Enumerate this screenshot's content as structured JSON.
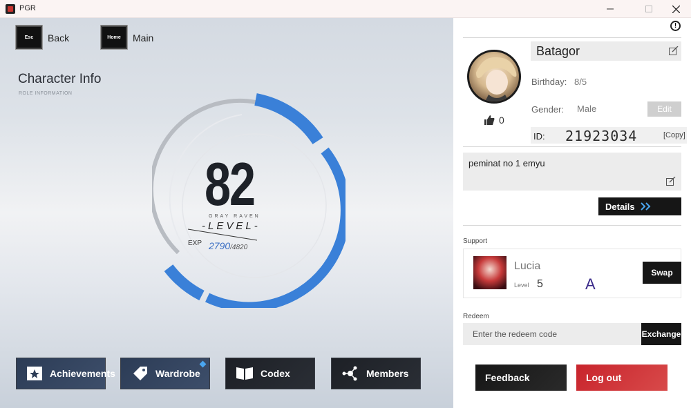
{
  "window": {
    "title": "PGR",
    "min_icon": "minimize-icon",
    "max_icon": "maximize-icon",
    "close_icon": "close-icon"
  },
  "topnav": {
    "back_key": "Esc",
    "back_label": "Back",
    "main_key": "Home",
    "main_label": "Main"
  },
  "character": {
    "title": "Character Info",
    "subtitle": "ROLE INFORMATION",
    "level": "82",
    "brand": "GRAY RAVEN",
    "level_word": "-LEVEL-",
    "exp_label": "EXP",
    "exp_current": "2790",
    "exp_max": "/4820",
    "exp_fraction": 0.579
  },
  "bottom_nav": [
    {
      "label": "Achievements",
      "icon": "achievements-icon"
    },
    {
      "label": "Wardrobe",
      "icon": "wardrobe-icon"
    },
    {
      "label": "Codex",
      "icon": "codex-icon"
    },
    {
      "label": "Members",
      "icon": "members-icon"
    }
  ],
  "profile": {
    "name": "Batagor",
    "birthday_label": "Birthday:",
    "birthday": "8/5",
    "gender_label": "Gender:",
    "gender": "Male",
    "edit_label": "Edit",
    "likes": "0",
    "id_label": "ID:",
    "id": "21923034",
    "copy_label": "[Copy]",
    "bio": "peminat no 1 emyu",
    "details_label": "Details"
  },
  "support": {
    "section_label": "Support",
    "name": "Lucia",
    "level_label": "Level",
    "level": "5",
    "rank": "A",
    "swap_label": "Swap"
  },
  "redeem": {
    "section_label": "Redeem",
    "placeholder": "Enter the redeem code",
    "exchange_label": "Exchange"
  },
  "footer": {
    "feedback_label": "Feedback",
    "logout_label": "Log out"
  },
  "colors": {
    "accent_blue": "#3a80d8",
    "logout_red": "#cc2e33"
  }
}
